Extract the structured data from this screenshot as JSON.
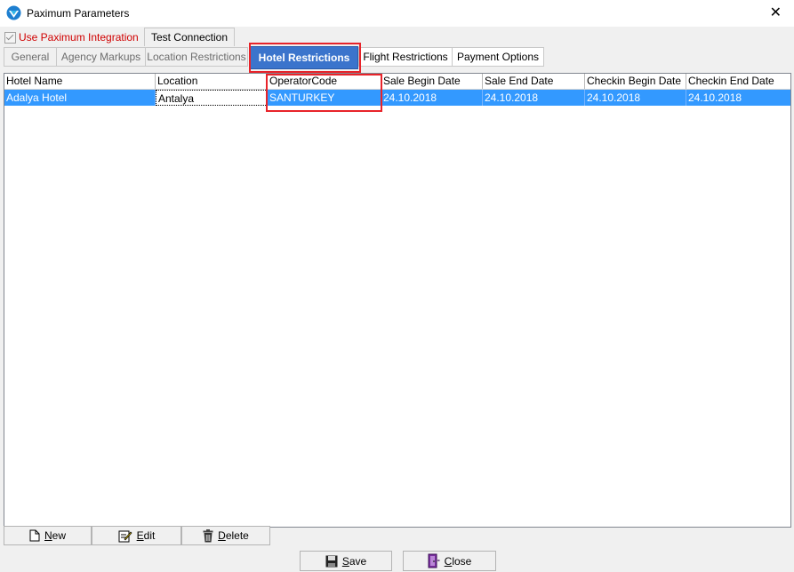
{
  "window": {
    "title": "Paximum Parameters",
    "close_glyph": "✕"
  },
  "options": {
    "use_integration_label": "Use Paximum Integration",
    "use_integration_checked": true,
    "test_connection_label": "Test Connection"
  },
  "tabs": [
    {
      "label": "General",
      "state": "disabled"
    },
    {
      "label": "Agency Markups",
      "state": "disabled"
    },
    {
      "label": "Location Restrictions",
      "state": "disabled"
    },
    {
      "label": "Hotel Restrictions",
      "state": "active"
    },
    {
      "label": "Flight Restrictions",
      "state": "normal"
    },
    {
      "label": "Payment Options",
      "state": "normal"
    }
  ],
  "grid": {
    "columns": [
      "Hotel Name",
      "Location",
      "OperatorCode",
      "Sale Begin Date",
      "Sale End Date",
      "Checkin Begin Date",
      "Checkin End Date"
    ],
    "rows": [
      [
        "Adalya Hotel",
        "Antalya",
        "SANTURKEY",
        "24.10.2018",
        "24.10.2018",
        "24.10.2018",
        "24.10.2018"
      ]
    ]
  },
  "actions": {
    "new_label": "New",
    "edit_label": "Edit",
    "delete_label": "Delete"
  },
  "footer": {
    "save_label": "Save",
    "close_label": "Close"
  },
  "colors": {
    "active_tab": "#3b74cc",
    "selection": "#3399ff",
    "annotation": "#e8232a",
    "checkbox_label": "#d00000"
  },
  "icons": {
    "app": "paximum-logo-icon",
    "new": "new-document-icon",
    "edit": "edit-icon",
    "delete": "trash-icon",
    "save": "floppy-disk-icon",
    "close": "door-exit-icon"
  }
}
